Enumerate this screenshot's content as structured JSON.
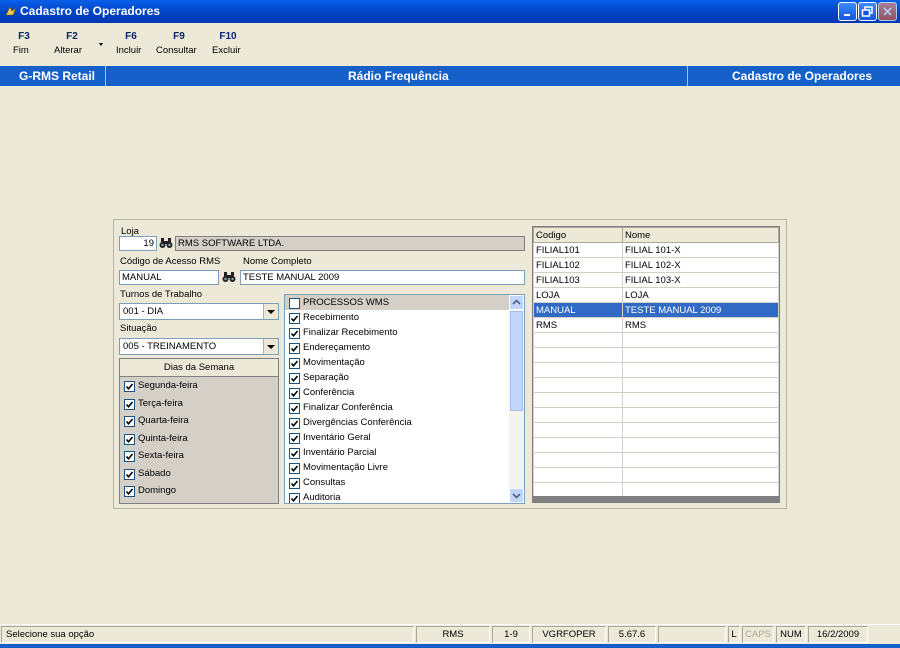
{
  "window": {
    "title": "Cadastro de Operadores"
  },
  "toolbar": {
    "buttons": [
      {
        "key": "F3",
        "label": "Fim"
      },
      {
        "key": "F2",
        "label": "Alterar"
      },
      {
        "key": "F6",
        "label": "Incluir"
      },
      {
        "key": "F9",
        "label": "Consultar"
      },
      {
        "key": "F10",
        "label": "Excluir"
      }
    ]
  },
  "header": {
    "left": "G-RMS Retail",
    "center": "Rádio Frequência",
    "right": "Cadastro de Operadores"
  },
  "form": {
    "loja_label": "Loja",
    "loja_code": "19",
    "loja_name": "RMS SOFTWARE LTDA.",
    "codigo_label": "Código de Acesso RMS",
    "nome_label": "Nome Completo",
    "codigo_value": "MANUAL",
    "nome_value": "TESTE MANUAL 2009",
    "turnos_label": "Turnos de Trabalho",
    "turno_value": "001 - DIA",
    "situacao_label": "Situação",
    "situacao_value": "005 - TREINAMENTO"
  },
  "days": {
    "header": "Dias da Semana",
    "items": [
      "Segunda-feira",
      "Terça-feira",
      "Quarta-feira",
      "Quinta-feira",
      "Sexta-feira",
      "Sábado",
      "Domingo"
    ]
  },
  "processes": {
    "header": "PROCESSOS WMS",
    "items": [
      "Recebimento",
      "Finalizar Recebimento",
      "Endereçamento",
      "Movimentação",
      "Separação",
      "Conferência",
      "Finalizar Conferência",
      "Divergências Conferência",
      "Inventário Geral",
      "Inventário Parcial",
      "Movimentação Livre",
      "Consultas",
      "Auditoria"
    ]
  },
  "grid": {
    "columns": [
      "Codigo",
      "Nome"
    ],
    "rows": [
      [
        "FILIAL101",
        "FILIAL 101-X"
      ],
      [
        "FILIAL102",
        "FILIAL 102-X"
      ],
      [
        "FILIAL103",
        "FILIAL 103-X"
      ],
      [
        "LOJA",
        "LOJA"
      ],
      [
        "MANUAL",
        "TESTE MANUAL 2009"
      ],
      [
        "RMS",
        "RMS"
      ]
    ],
    "selected_row": 4
  },
  "statusbar": {
    "message": "Selecione sua opção",
    "system": "RMS",
    "page": "1-9",
    "program": "VGRFOPER",
    "version": "5.67.6",
    "l": "L",
    "caps": "CAPS",
    "num": "NUM",
    "date": "16/2/2009"
  },
  "colors": {
    "titlebar": "#0246C8",
    "header_bar": "#1560C8",
    "selection": "#316AC5",
    "background": "#ECE9D8"
  }
}
